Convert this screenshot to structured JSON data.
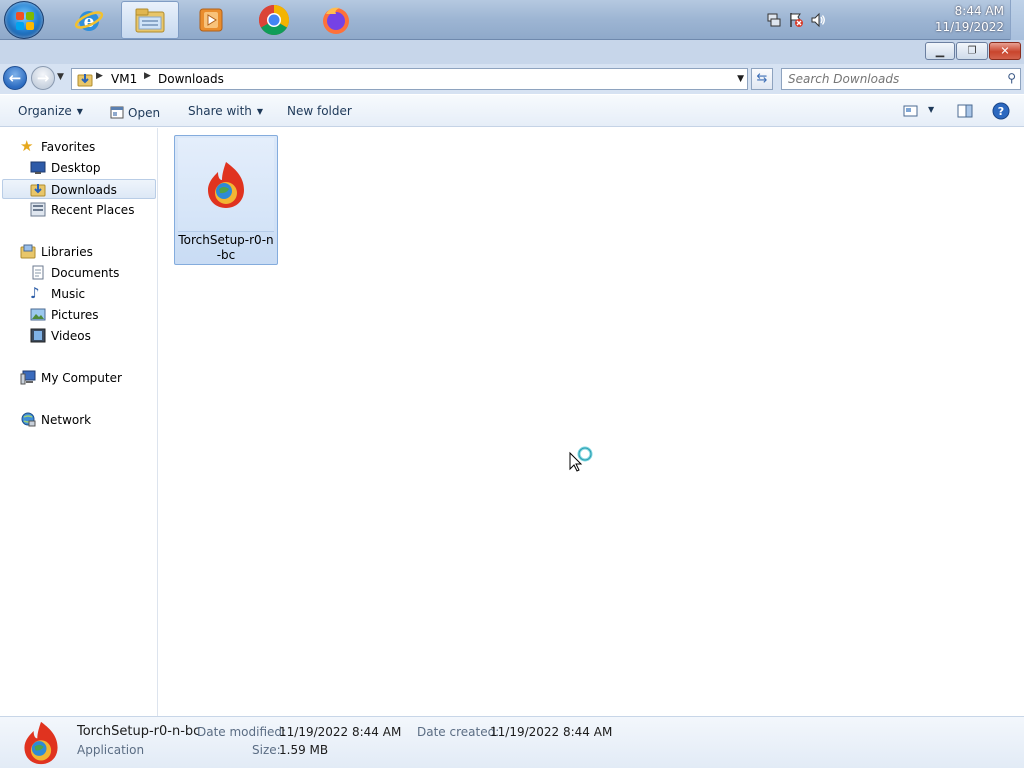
{
  "taskbar": {
    "apps": [
      {
        "name": "internet-explorer"
      },
      {
        "name": "windows-explorer",
        "active": true
      },
      {
        "name": "windows-media-player"
      },
      {
        "name": "google-chrome"
      },
      {
        "name": "mozilla-firefox"
      }
    ],
    "clock": {
      "time": "8:44 AM",
      "date": "11/19/2022"
    }
  },
  "address": {
    "crumbs": [
      "VM1",
      "Downloads"
    ]
  },
  "search": {
    "placeholder": "Search Downloads"
  },
  "toolbar": {
    "organize": "Organize",
    "open": "Open",
    "share_with": "Share with",
    "new_folder": "New folder"
  },
  "nav": {
    "favorites": "Favorites",
    "desktop": "Desktop",
    "downloads": "Downloads",
    "recent_places": "Recent Places",
    "libraries": "Libraries",
    "documents": "Documents",
    "music": "Music",
    "pictures": "Pictures",
    "videos": "Videos",
    "my_computer": "My Computer",
    "network": "Network"
  },
  "files": [
    {
      "name": "TorchSetup-r0-n-bc"
    }
  ],
  "details": {
    "name": "TorchSetup-r0-n-bc",
    "type": "Application",
    "date_modified_label": "Date modified:",
    "date_modified": "11/19/2022 8:44 AM",
    "size_label": "Size:",
    "size": "1.59 MB",
    "date_created_label": "Date created:",
    "date_created": "11/19/2022 8:44 AM"
  },
  "colors": {
    "accent": "#3d6eb6",
    "selection": "#cfe0f6"
  }
}
